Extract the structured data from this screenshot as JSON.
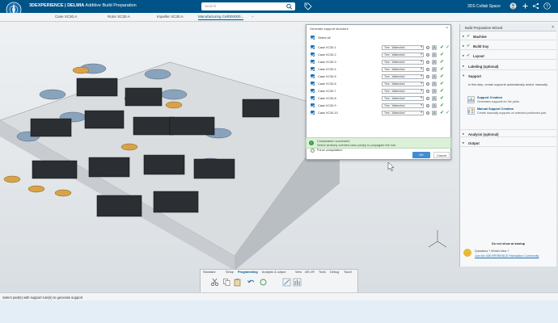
{
  "header": {
    "brand_bold": "3DEXPERIENCE | DELMIA",
    "brand_app": "Additive Build Preparation",
    "search_placeholder": "Search",
    "collab_space": "3DS Collab Space",
    "icons": [
      "compass-icon",
      "search-icon",
      "tag-icon",
      "user-icon",
      "share-icon",
      "help-icon"
    ],
    "color": "#005386"
  },
  "tabs": [
    {
      "label": "Case XC30.A"
    },
    {
      "label": "Rotor XC30.A"
    },
    {
      "label": "Impeller XC30.A"
    },
    {
      "label": "Manufacturing Cell000000..."
    }
  ],
  "dialog": {
    "title": "Generate support structure",
    "select_all": "Select all",
    "rows": [
      {
        "label": "Case XC30.1",
        "option": "Tree - Watershed"
      },
      {
        "label": "Case XC30.2",
        "option": "Tree - Watershed"
      },
      {
        "label": "Case XC30.3",
        "option": "Tree - Watershed"
      },
      {
        "label": "Case XC30.4",
        "option": "Tree - Watershed"
      },
      {
        "label": "Case XC30.5",
        "option": "Tree - Watershed"
      },
      {
        "label": "Case XC30.6",
        "option": "Tree - Watershed"
      },
      {
        "label": "Case XC30.7",
        "option": "Tree - Watershed"
      },
      {
        "label": "Case XC30.8",
        "option": "Tree - Watershed"
      },
      {
        "label": "Case XC30.9",
        "option": "Tree - Watershed"
      },
      {
        "label": "Case XC30.10",
        "option": "Tree - Watershed"
      }
    ],
    "global_option": "Tree - Watershed",
    "force_computation": "Force computation",
    "notice_title": "Computation successful",
    "notice_text": "Select similarly oriented case part(s) to propagate the rule.",
    "ok": "OK",
    "cancel": "Cancel"
  },
  "wizard": {
    "title": "Build Preparation Wizard",
    "sections": [
      {
        "label": "Machine",
        "done": true
      },
      {
        "label": "Build tray",
        "done": true
      },
      {
        "label": "Layout",
        "done": true
      },
      {
        "label": "Labeling (optional)",
        "done": false
      }
    ],
    "support": {
      "label": "Support",
      "description": "In this step, create supports automatically and/or manually.",
      "items": [
        {
          "title": "Support Creation",
          "desc": "Generates supports for the parts."
        },
        {
          "title": "Manual Support Creation",
          "desc": "Create manually supports on selected positioned part."
        }
      ]
    },
    "after": [
      {
        "label": "Analysis (optional)"
      },
      {
        "label": "Output"
      }
    ],
    "dont_show": "Do not show at startup",
    "question": "Questions ? What's New ?",
    "community": "Join the 3DEXPERIENCE Fabrication Community"
  },
  "actionbar": {
    "tabs": [
      "Standard",
      "Setup",
      "Programming",
      "Analysis & output",
      "View",
      "AR-VR",
      "Tools",
      "Debug",
      "Touch"
    ],
    "active": "Programming"
  },
  "status": {
    "text": "Select part(s) with support rule(s) to generate support"
  }
}
